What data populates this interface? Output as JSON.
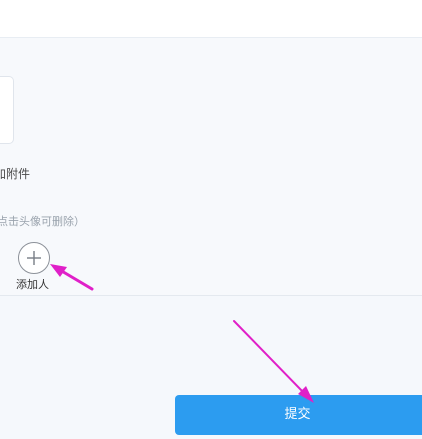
{
  "form": {
    "attach_label": "加附件",
    "hint": "点击头像可删除）",
    "add_person_label": "添加人",
    "add_icon": "plus-circle-icon"
  },
  "actions": {
    "submit_label": "提交"
  },
  "colors": {
    "accent": "#2c9cf0",
    "annotation_arrow": "#e020c8"
  }
}
